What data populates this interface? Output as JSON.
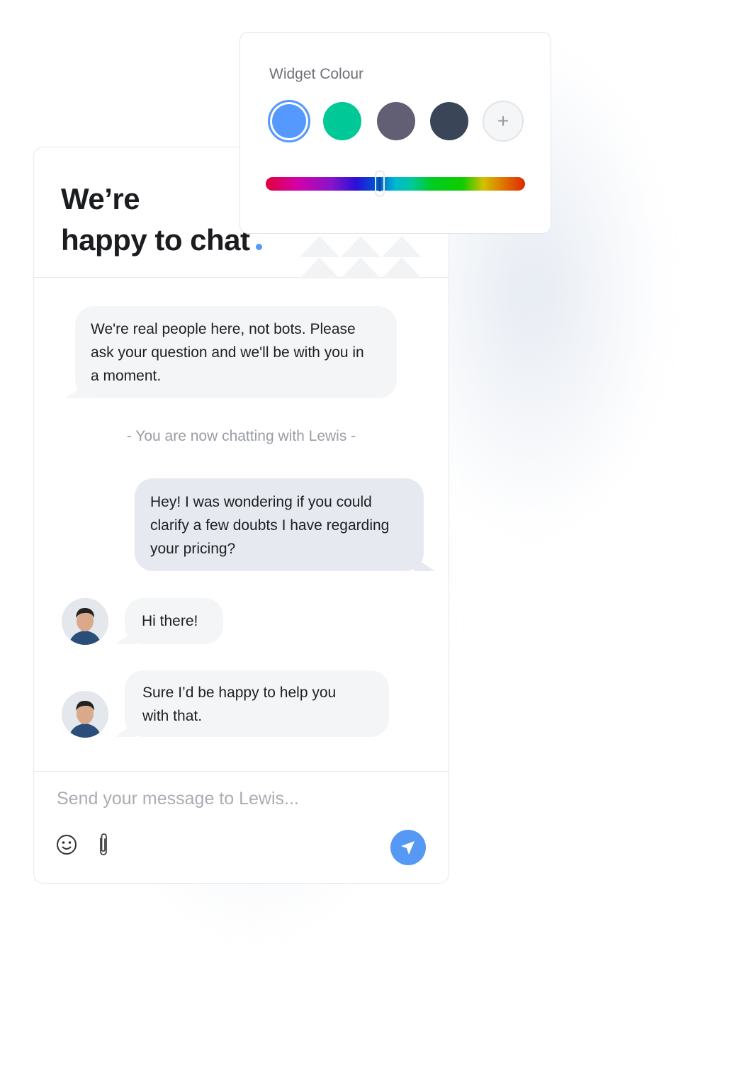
{
  "chat": {
    "title_line1": "We’re",
    "title_line2": "happy to chat",
    "messages": [
      {
        "from": "agent",
        "text": "We're real people here, not bots. Please ask your question and we'll be with you in a moment."
      },
      {
        "from": "system",
        "text": "- You are now chatting with Lewis -"
      },
      {
        "from": "user",
        "text": "Hey! I was wondering if you could clarify a few doubts I have regarding your pricing?"
      },
      {
        "from": "agent",
        "text": "Hi there!"
      },
      {
        "from": "agent",
        "text": "Sure I’d be happy to help you with that."
      }
    ],
    "input_placeholder": "Send your message to Lewis...",
    "icons": [
      "smiley-icon",
      "paperclip-icon",
      "send-icon"
    ],
    "accent": "#5599F5"
  },
  "widget": {
    "title": "Widget Colour",
    "swatches": [
      "#5599FF",
      "#00C896",
      "#625F75",
      "#3A4657"
    ],
    "selected_swatch": 0,
    "add_label": "+",
    "hue_position_percent": 44
  }
}
